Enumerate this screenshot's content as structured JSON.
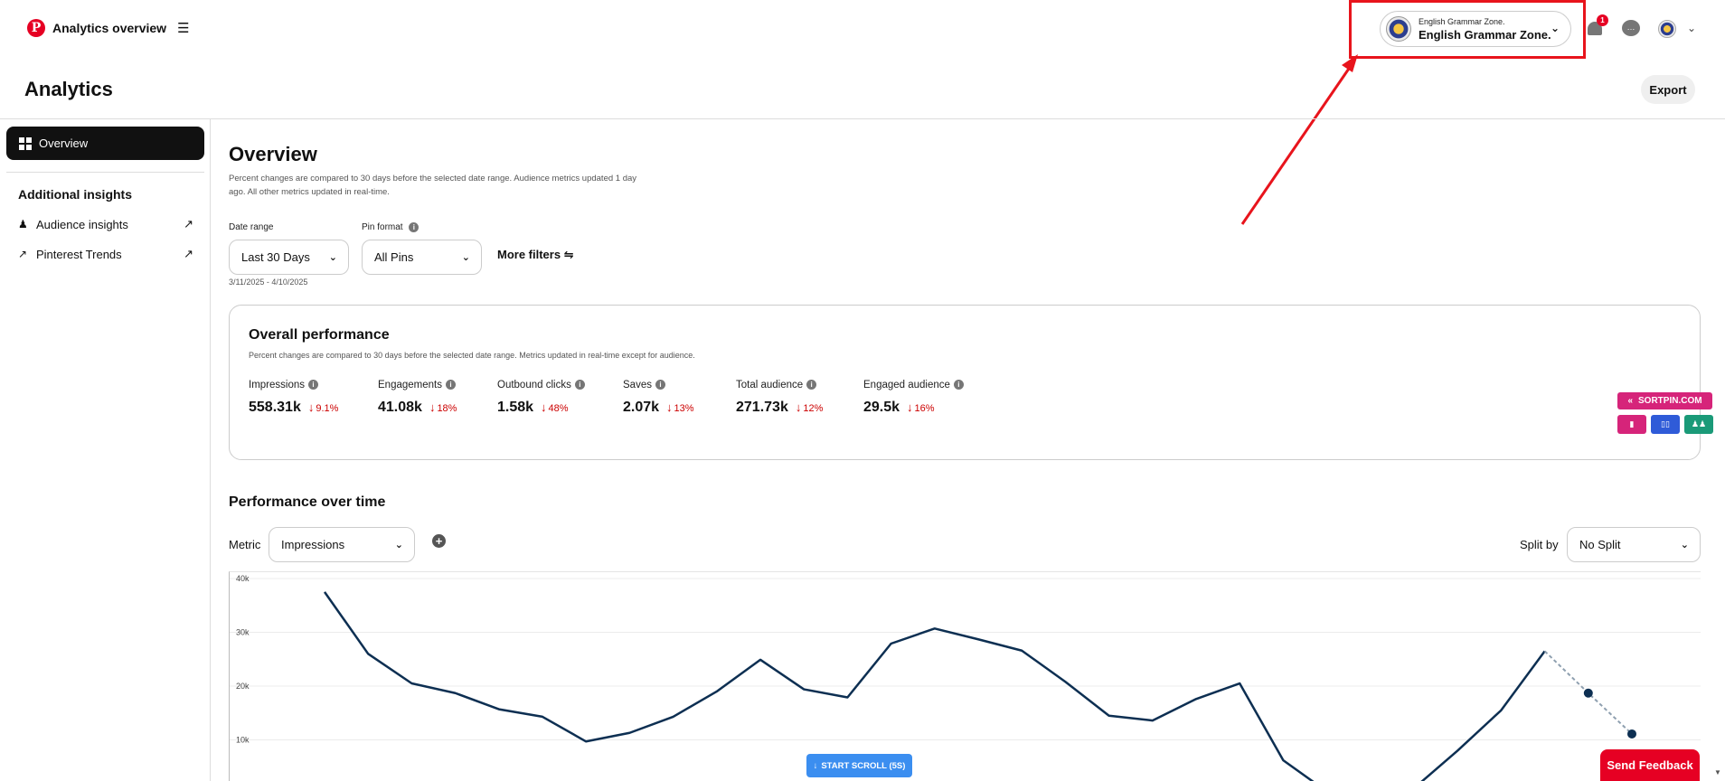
{
  "header": {
    "brand_logo_letter": "P",
    "title": "Analytics overview",
    "account": {
      "small_label": "English Grammar Zone.",
      "name": "English Grammar Zone."
    },
    "notification_count": "1"
  },
  "page": {
    "title": "Analytics",
    "export_label": "Export"
  },
  "sidebar": {
    "overview_label": "Overview",
    "section_heading": "Additional insights",
    "items": [
      {
        "label": "Audience insights"
      },
      {
        "label": "Pinterest Trends"
      }
    ]
  },
  "overview": {
    "title": "Overview",
    "note": "Percent changes are compared to 30 days before the selected date range. Audience metrics updated 1 day ago. All other metrics updated in real-time."
  },
  "filters": {
    "date_range_label": "Date range",
    "date_range_value": "Last 30 Days",
    "date_range_sub": "3/11/2025 - 4/10/2025",
    "pin_format_label": "Pin format",
    "pin_format_value": "All Pins",
    "more_filters_label": "More filters"
  },
  "performance": {
    "title": "Overall performance",
    "note": "Percent changes are compared to 30 days before the selected date range. Metrics updated in real-time except for audience.",
    "metrics": [
      {
        "label": "Impressions",
        "value": "558.31k",
        "change": "9.1%"
      },
      {
        "label": "Engagements",
        "value": "41.08k",
        "change": "18%"
      },
      {
        "label": "Outbound clicks",
        "value": "1.58k",
        "change": "48%"
      },
      {
        "label": "Saves",
        "value": "2.07k",
        "change": "13%"
      },
      {
        "label": "Total audience",
        "value": "271.73k",
        "change": "12%"
      },
      {
        "label": "Engaged audience",
        "value": "29.5k",
        "change": "16%"
      }
    ]
  },
  "over_time": {
    "title": "Performance over time",
    "metric_label": "Metric",
    "metric_value": "Impressions",
    "split_label": "Split by",
    "split_value": "No Split"
  },
  "chart_data": {
    "type": "line",
    "title": "",
    "xlabel": "",
    "ylabel": "",
    "ylim": [
      0,
      40000
    ],
    "yticks": [
      "40k",
      "30k",
      "20k",
      "10k"
    ],
    "grid": true,
    "series": [
      {
        "values": [
          37500,
          26000,
          20500,
          18700,
          15700,
          14300,
          9700,
          11300,
          14300,
          19000,
          24900,
          19400,
          17900,
          27900,
          30700,
          28700,
          26600,
          20800,
          14500,
          13600,
          17600,
          20500,
          6200,
          400,
          200,
          1000,
          8000,
          15500,
          26500
        ],
        "style": "solid"
      },
      {
        "values": [
          null,
          null,
          null,
          null,
          null,
          null,
          null,
          null,
          null,
          null,
          null,
          null,
          null,
          null,
          null,
          null,
          null,
          null,
          null,
          null,
          null,
          null,
          null,
          null,
          null,
          null,
          null,
          null,
          26500,
          18700,
          11100
        ],
        "style": "dashed"
      }
    ],
    "line_color": "#0d2f52",
    "projection_color": "#8fa0b0"
  },
  "extension": {
    "sortpin_label": "SORTPIN.COM",
    "button_colors": [
      "#d6247a",
      "#2f5bd8",
      "#1a9a78"
    ]
  },
  "overlays": {
    "start_scroll_label": "START SCROLL (5S)",
    "send_feedback_label": "Send Feedback"
  },
  "annotation": {
    "color": "#e8141c"
  }
}
